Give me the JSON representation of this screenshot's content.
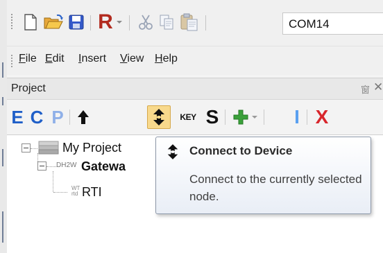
{
  "toolbar": {
    "port_value": "COM14",
    "r_label": "R",
    "colors": {
      "r_button": "#c0392b",
      "folder": "#f2b632",
      "save": "#3a5fcd"
    }
  },
  "menu": {
    "items": [
      "File",
      "Edit",
      "Insert",
      "View",
      "Help"
    ]
  },
  "panel": {
    "title": "Project",
    "pin_glyph": "窗",
    "close_glyph": "✕"
  },
  "project_toolbar": {
    "e_label": "E",
    "c_label": "C",
    "p_label": "P",
    "key_label": "KEY",
    "s_label": "S",
    "i_label": "I",
    "x_label": "X",
    "colors": {
      "e": "#1f5fc8",
      "c": "#1f5fc8",
      "p": "#8fb0e8",
      "i": "#5aa0f0",
      "x": "#d8262c",
      "plus": "#3aa03a"
    }
  },
  "tree": {
    "root_label": "My Project",
    "gateway_tag": "DH2W",
    "gateway_label": "Gatewa",
    "node_tag_line1": "WT",
    "node_tag_line2": "rtd",
    "node_label": "RTI"
  },
  "tooltip": {
    "title": "Connect to Device",
    "body": "Connect to the currently selected node."
  }
}
